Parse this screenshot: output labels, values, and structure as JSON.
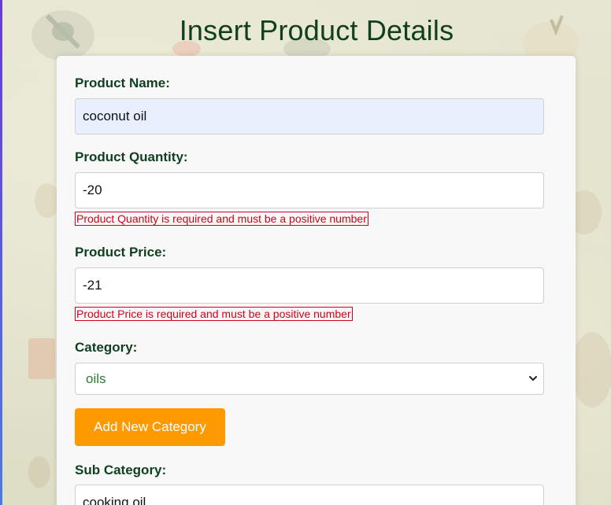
{
  "page": {
    "title": "Insert Product Details"
  },
  "form": {
    "product_name": {
      "label": "Product Name:",
      "value": "coconut oil"
    },
    "product_quantity": {
      "label": "Product Quantity:",
      "value": "-20",
      "error": "Product Quantity is required and must be a positive number"
    },
    "product_price": {
      "label": "Product Price:",
      "value": "-21",
      "error": "Product Price is required and must be a positive number"
    },
    "category": {
      "label": "Category:",
      "selected": "oils"
    },
    "add_category_button": "Add New Category",
    "sub_category": {
      "label": "Sub Category:",
      "value": "cooking oil"
    }
  },
  "colors": {
    "title": "#0f3f1e",
    "label": "#0f3f1e",
    "error": "#d0021b",
    "button": "#ff9900",
    "select_text": "#2e7d32",
    "autofill_background": "#e8f0fe"
  },
  "icons": {
    "select_arrow": "chevron-down-icon"
  }
}
